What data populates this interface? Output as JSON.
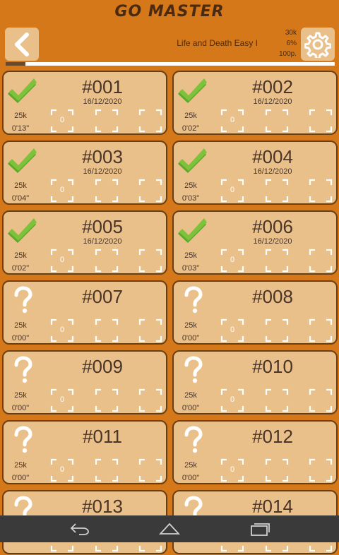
{
  "app": {
    "title": "GO MASTER"
  },
  "header": {
    "level_name": "Life and Death Easy I",
    "stat_top": "30k",
    "stat_percent": "6%",
    "stat_points": "100p.",
    "progress_fraction": 0.06
  },
  "colors": {
    "background": "#d4781a",
    "card": "#e9c08a",
    "card_border": "#6b3e12",
    "check": "#7dc23a",
    "question": "#ffffff",
    "navbar": "#3a3a3a"
  },
  "cards": [
    {
      "num": "#001",
      "date": "16/12/2020",
      "rank": "25k",
      "time": "0'13\"",
      "count": "0",
      "solved": true,
      "icon": "checkmark-icon"
    },
    {
      "num": "#002",
      "date": "16/12/2020",
      "rank": "25k",
      "time": "0'02\"",
      "count": "0",
      "solved": true,
      "icon": "checkmark-icon"
    },
    {
      "num": "#003",
      "date": "16/12/2020",
      "rank": "25k",
      "time": "0'04\"",
      "count": "0",
      "solved": true,
      "icon": "checkmark-icon"
    },
    {
      "num": "#004",
      "date": "16/12/2020",
      "rank": "25k",
      "time": "0'03\"",
      "count": "0",
      "solved": true,
      "icon": "checkmark-icon"
    },
    {
      "num": "#005",
      "date": "16/12/2020",
      "rank": "25k",
      "time": "0'02\"",
      "count": "0",
      "solved": true,
      "icon": "checkmark-icon"
    },
    {
      "num": "#006",
      "date": "16/12/2020",
      "rank": "25k",
      "time": "0'03\"",
      "count": "0",
      "solved": true,
      "icon": "checkmark-icon"
    },
    {
      "num": "#007",
      "date": "",
      "rank": "25k",
      "time": "0'00\"",
      "count": "0",
      "solved": false,
      "icon": "question-mark-icon"
    },
    {
      "num": "#008",
      "date": "",
      "rank": "25k",
      "time": "0'00\"",
      "count": "0",
      "solved": false,
      "icon": "question-mark-icon"
    },
    {
      "num": "#009",
      "date": "",
      "rank": "25k",
      "time": "0'00\"",
      "count": "0",
      "solved": false,
      "icon": "question-mark-icon"
    },
    {
      "num": "#010",
      "date": "",
      "rank": "25k",
      "time": "0'00\"",
      "count": "0",
      "solved": false,
      "icon": "question-mark-icon"
    },
    {
      "num": "#011",
      "date": "",
      "rank": "25k",
      "time": "0'00\"",
      "count": "0",
      "solved": false,
      "icon": "question-mark-icon"
    },
    {
      "num": "#012",
      "date": "",
      "rank": "25k",
      "time": "0'00\"",
      "count": "0",
      "solved": false,
      "icon": "question-mark-icon"
    },
    {
      "num": "#013",
      "date": "",
      "rank": "",
      "time": "",
      "count": "",
      "solved": false,
      "icon": "question-mark-icon"
    },
    {
      "num": "#014",
      "date": "",
      "rank": "",
      "time": "",
      "count": "",
      "solved": false,
      "icon": "question-mark-icon"
    }
  ],
  "navbar": {
    "back_icon": "nav-back-icon",
    "home_icon": "nav-home-icon",
    "recents_icon": "nav-recents-icon"
  }
}
